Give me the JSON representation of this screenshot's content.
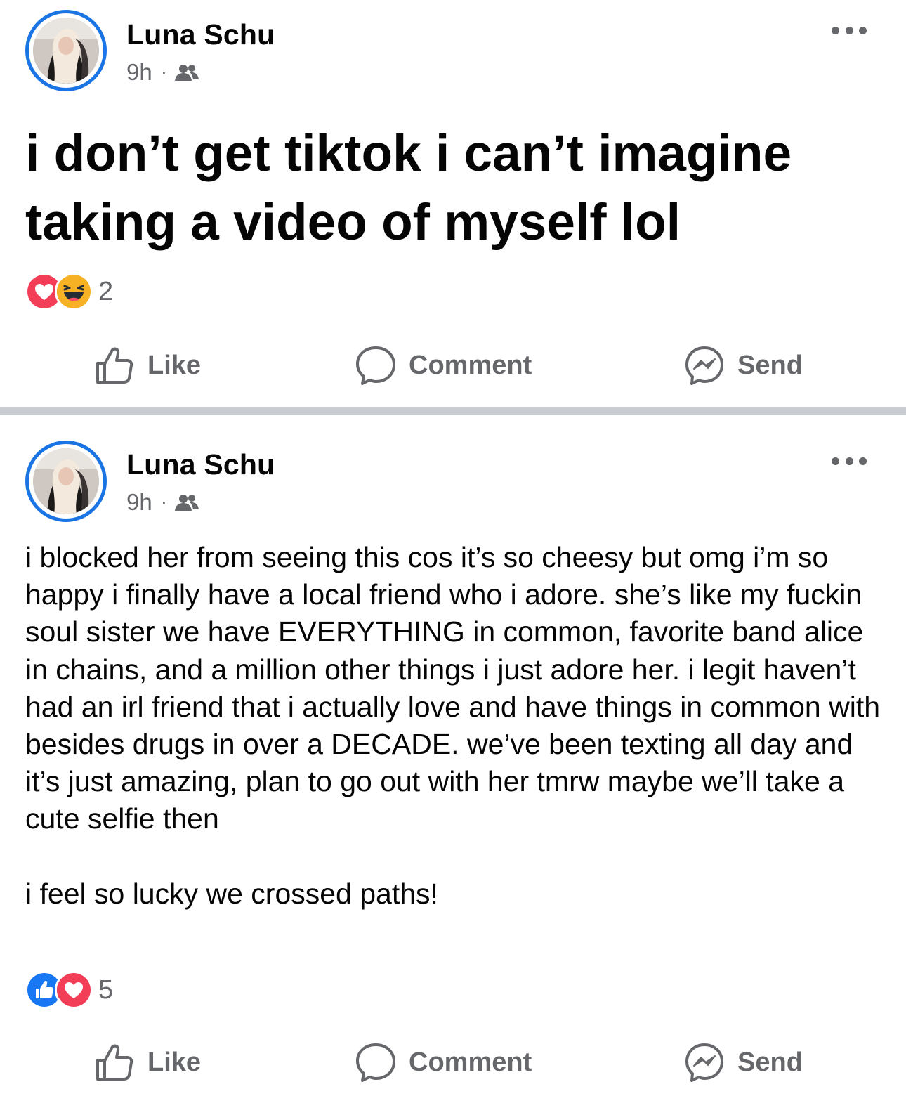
{
  "posts": [
    {
      "author": "Luna Schu",
      "time": "9h",
      "separator": "·",
      "audience_icon": "friends-icon",
      "text": "i don’t get tiktok i can’t imagine taking a video of myself lol",
      "reactions": {
        "types": [
          "love",
          "haha"
        ],
        "count": "2"
      },
      "actions": {
        "like": "Like",
        "comment": "Comment",
        "send": "Send"
      }
    },
    {
      "author": "Luna Schu",
      "time": "9h",
      "separator": "·",
      "audience_icon": "friends-icon",
      "text": "i blocked her from seeing this cos it’s so cheesy but omg i’m so happy i finally have a local friend who i adore. she’s like my fuckin soul sister we have EVERYTHING in common, favorite band alice in chains, and a million other things i just adore her. i legit haven’t had an irl friend that i actually love and have things in common with besides drugs in over a DECADE. we’ve been texting all day and it’s just amazing, plan to go out with her tmrw maybe we’ll take a cute selfie then\n\ni feel so lucky we crossed paths!",
      "reactions": {
        "types": [
          "like",
          "love"
        ],
        "count": "5"
      },
      "actions": {
        "like": "Like",
        "comment": "Comment",
        "send": "Send"
      }
    }
  ],
  "colors": {
    "accent": "#1b74e4",
    "secondary_text": "#65676b",
    "separator": "#c9ccd1",
    "love": "#f33e58",
    "haha": "#f7b125",
    "like": "#1877f2"
  }
}
